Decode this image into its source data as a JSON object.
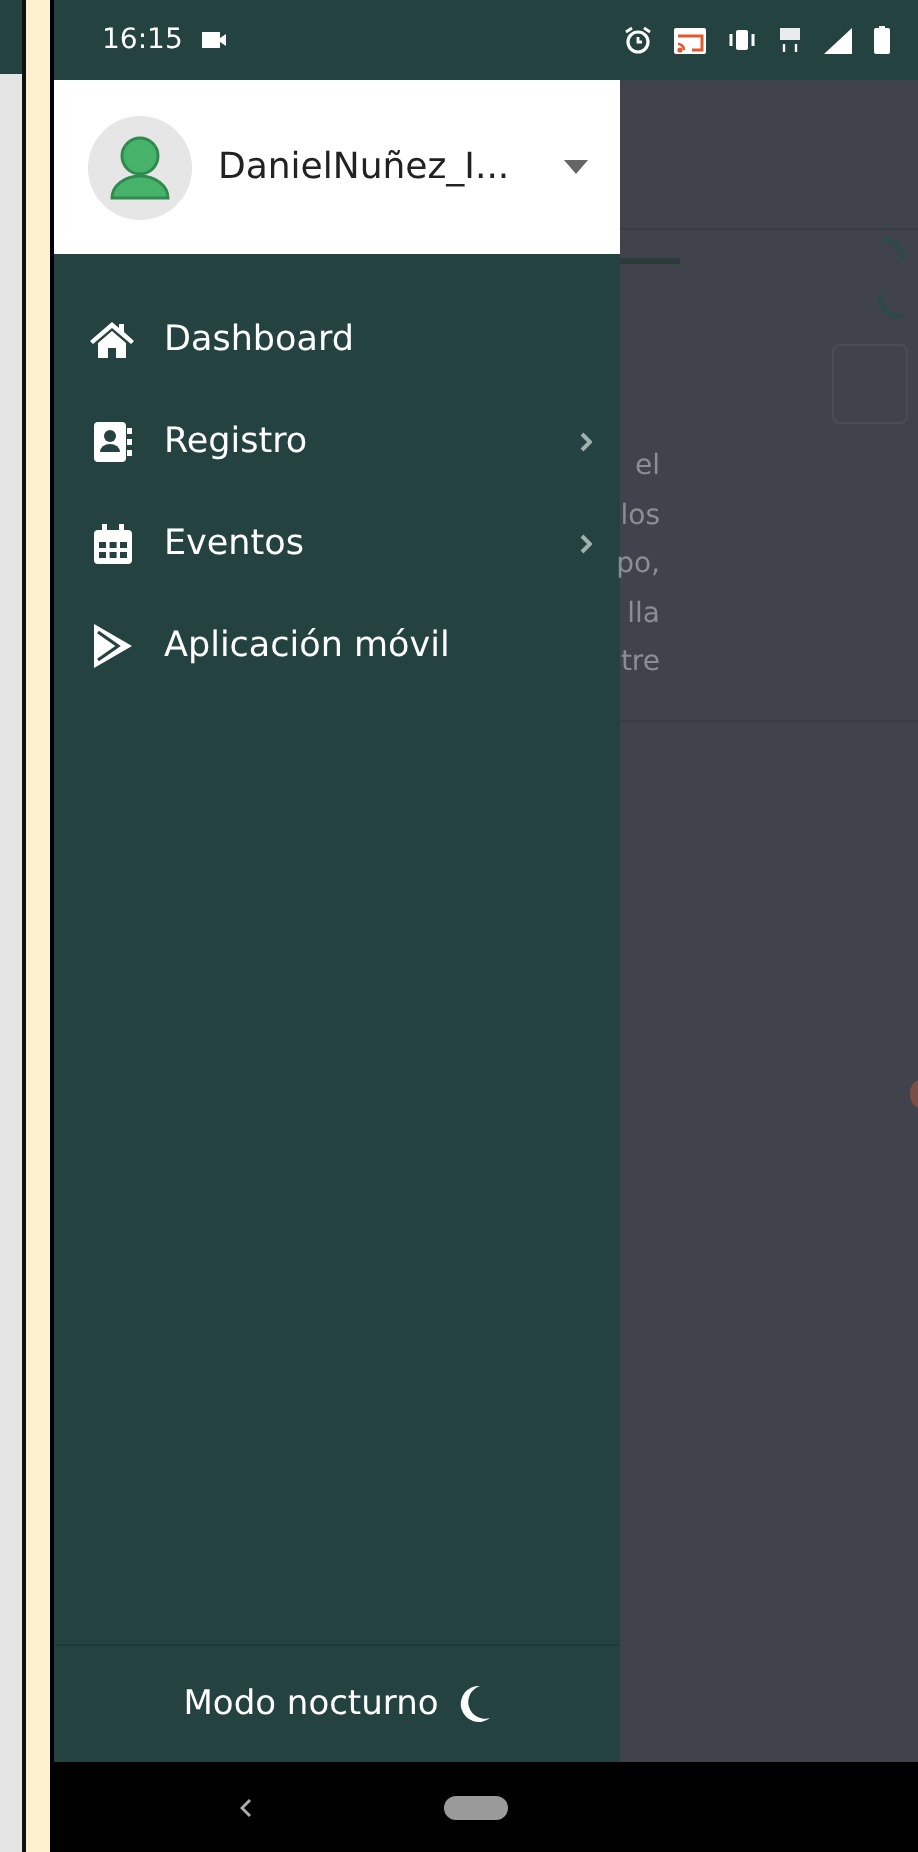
{
  "status_bar": {
    "time": "16:15"
  },
  "drawer": {
    "user": {
      "name": "DanielNuñez_I..."
    },
    "items": [
      {
        "label": "Dashboard",
        "has_submenu": false
      },
      {
        "label": "Registro",
        "has_submenu": true
      },
      {
        "label": "Eventos",
        "has_submenu": true
      },
      {
        "label": "Aplicación móvil",
        "has_submenu": false
      }
    ],
    "footer": {
      "label": "Modo nocturno"
    }
  },
  "background_text": [
    "el",
    "los",
    "po,",
    "lla",
    "tre"
  ]
}
